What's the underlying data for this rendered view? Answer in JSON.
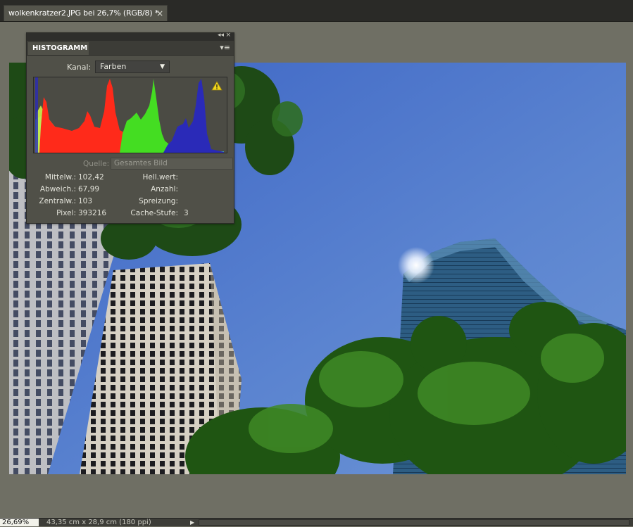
{
  "document": {
    "tab_title": "wolkenkratzer2.JPG bei 26,7% (RGB/8) *",
    "close_icon": "×"
  },
  "histogram_panel": {
    "top_collapse": "◂◂",
    "top_close": "×",
    "tab_label": "HISTOGRAMM",
    "menu_icon": "▾≡",
    "kanal_label": "Kanal:",
    "kanal_value": "Farben",
    "warning_icon": "warning-triangle",
    "quelle_label": "Quelle:",
    "quelle_value": "Gesamtes Bild",
    "stats_left": [
      {
        "label": "Mittelw.:",
        "value": "102,42"
      },
      {
        "label": "Abweich.:",
        "value": "67,99"
      },
      {
        "label": "Zentralw.:",
        "value": "103"
      },
      {
        "label": "Pixel:",
        "value": "393216"
      }
    ],
    "stats_right": [
      {
        "label": "Hell.wert:",
        "value": ""
      },
      {
        "label": "Anzahl:",
        "value": ""
      },
      {
        "label": "Spreizung:",
        "value": ""
      },
      {
        "label": "Cache-Stufe:",
        "value": "3"
      }
    ]
  },
  "statusbar": {
    "zoom": "26,69%",
    "doc_size": "43,35 cm x 28,9 cm (180 ppi)",
    "arrow_icon": "▶"
  },
  "colors": {
    "histogram_red": "#ff2a1a",
    "histogram_green": "#44dd22",
    "histogram_blue": "#2a2ab8",
    "histogram_yellow": "#cdf04a",
    "histogram_cyan": "#38c7c7"
  }
}
